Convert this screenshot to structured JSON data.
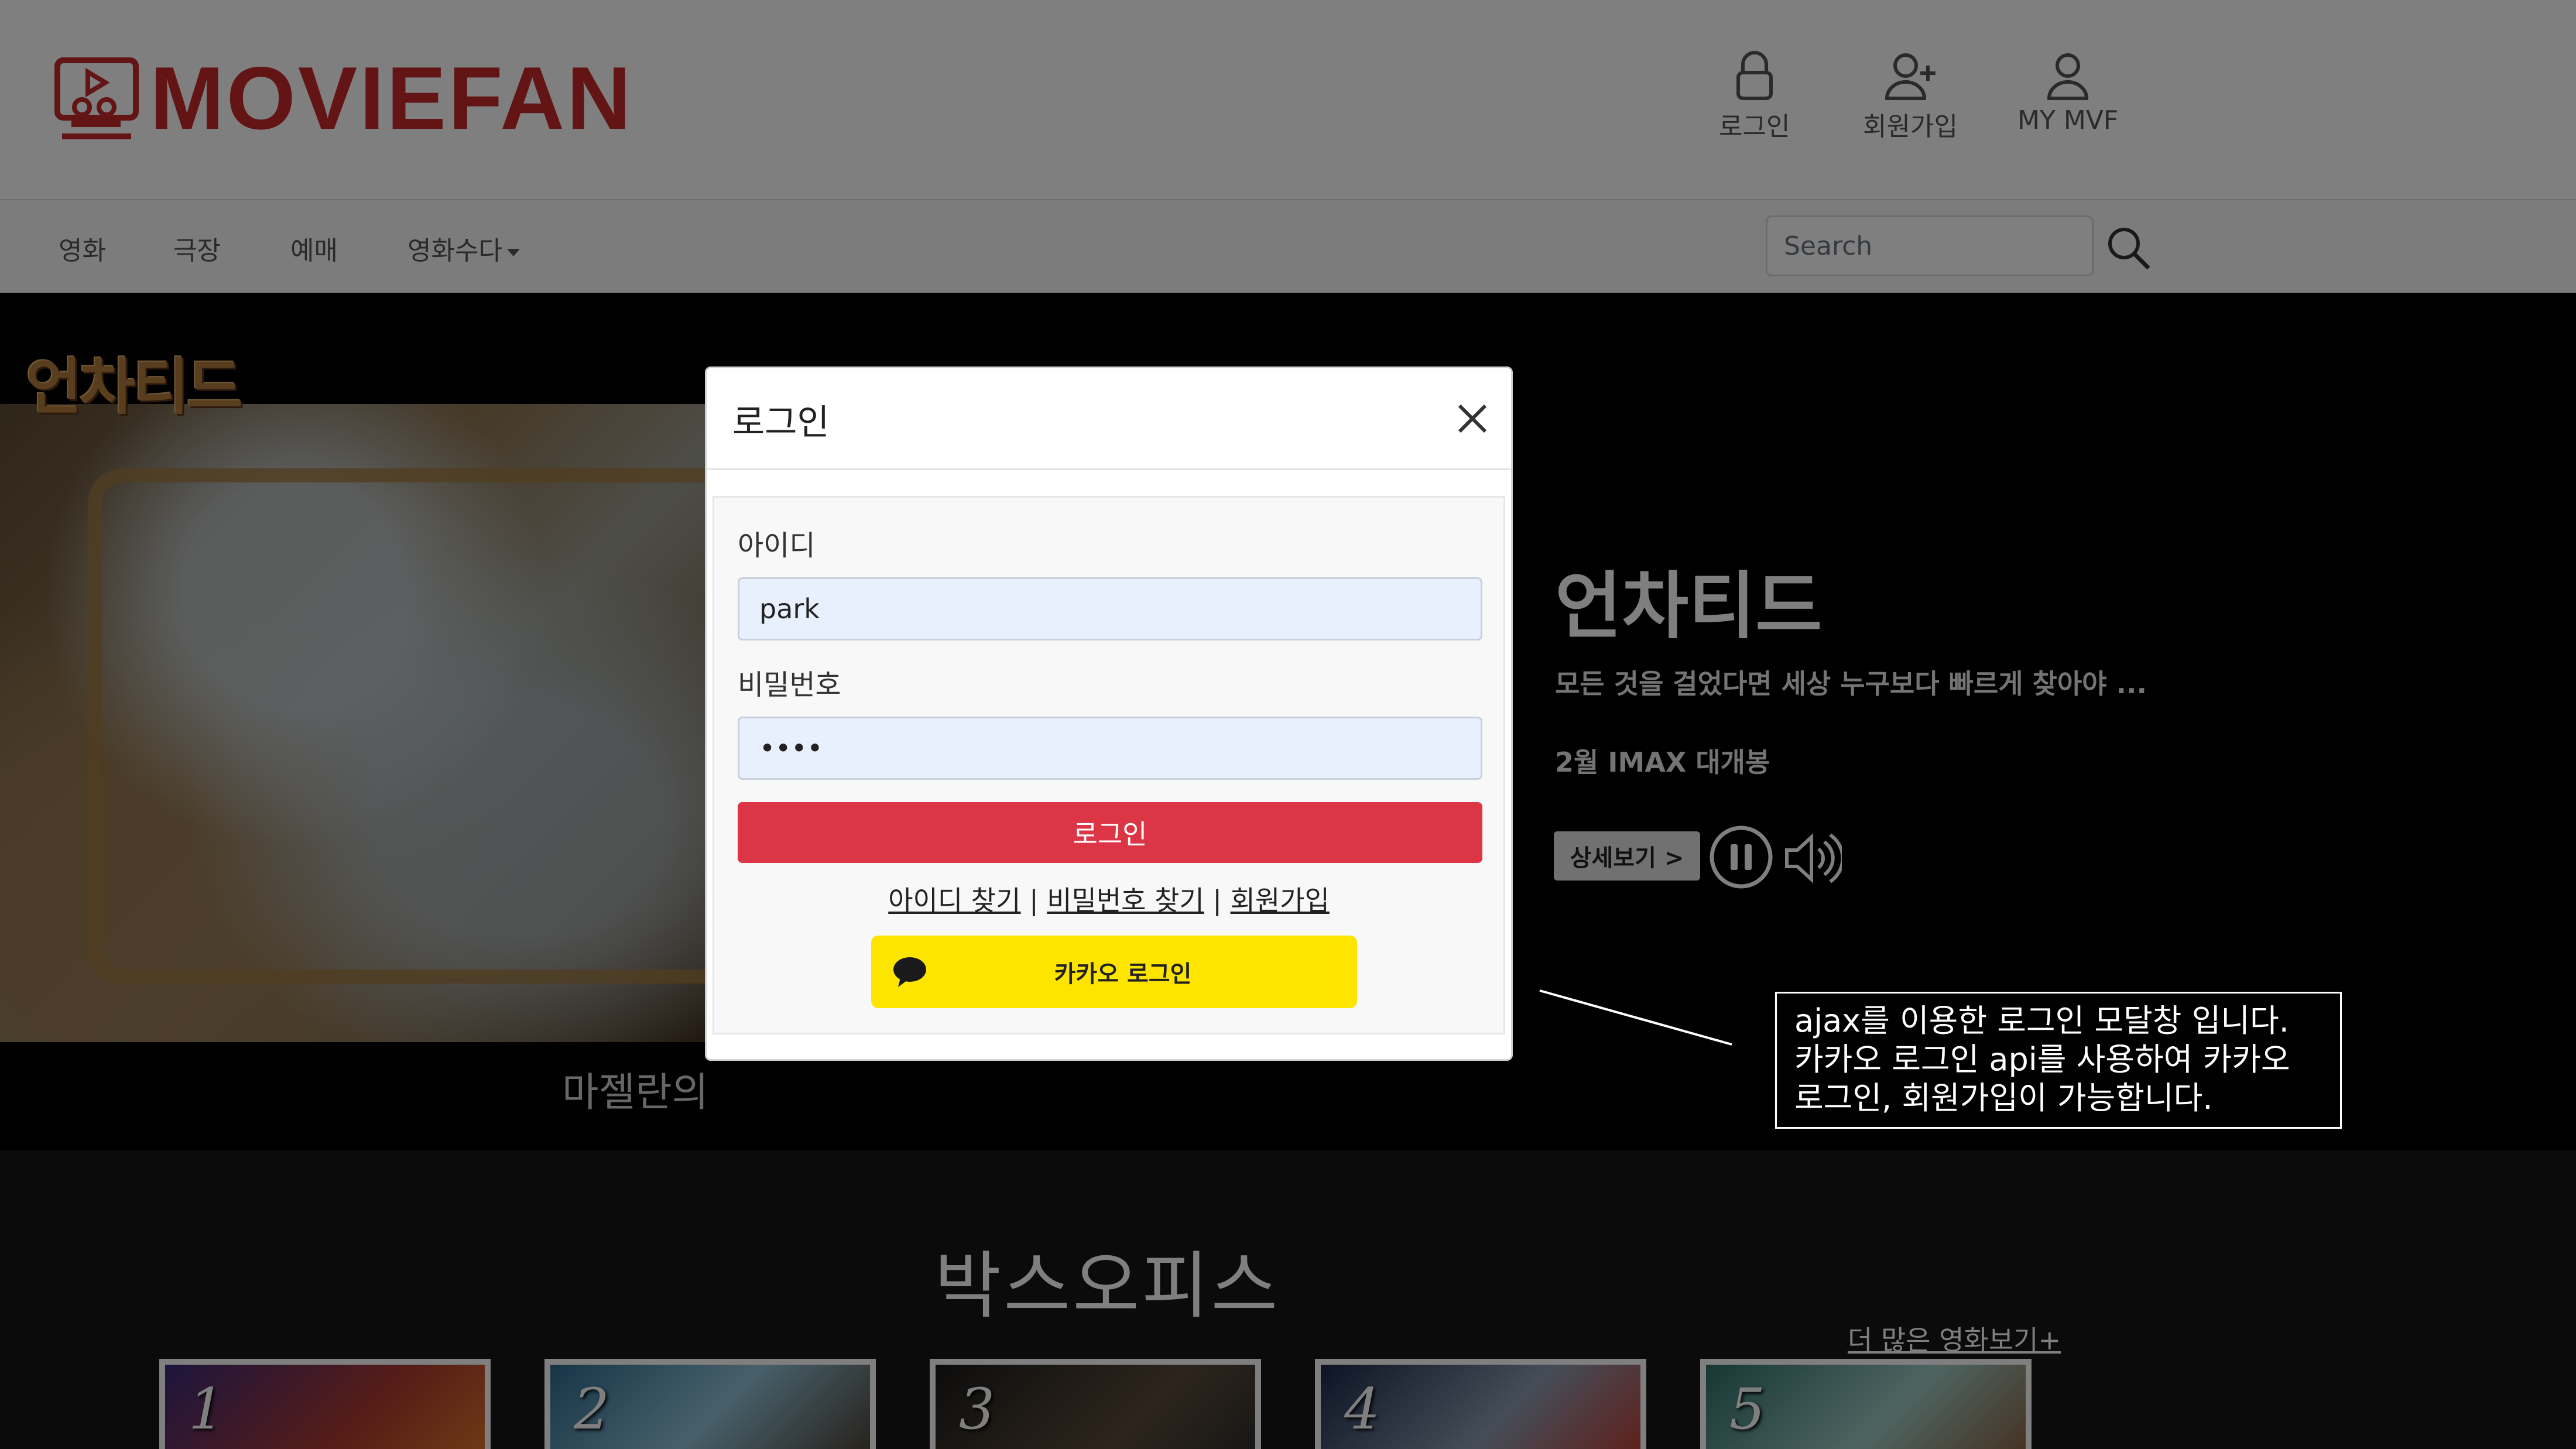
{
  "header": {
    "logo_text": "MOVIEFAN",
    "nav": [
      {
        "label": "로그인",
        "icon": "lock-icon"
      },
      {
        "label": "회원가입",
        "icon": "user-plus-icon"
      },
      {
        "label": "MY MVF",
        "icon": "user-icon"
      }
    ]
  },
  "navbar": {
    "menu": [
      "영화",
      "극장",
      "예매",
      "영화수다"
    ],
    "search_placeholder": "Search"
  },
  "hero": {
    "title_image_text": "언차티드",
    "map_caption": "마젤란의",
    "movie_title": "언차티드",
    "tagline": "모든 것을 걸었다면 세상 누구보다 빠르게 찾아야 ...",
    "release": "2월 IMAX 대개봉",
    "detail_button": "상세보기 >"
  },
  "boxoffice": {
    "title": "박스오피스",
    "more_link": "더 많은 영화보기+",
    "posters": [
      "1",
      "2",
      "3",
      "4",
      "5"
    ]
  },
  "modal": {
    "title": "로그인",
    "id_label": "아이디",
    "id_value": "park",
    "pw_label": "비밀번호",
    "pw_value": "pass",
    "login_button": "로그인",
    "links": [
      "아이디 찾기",
      "비밀번호 찾기",
      "회원가입"
    ],
    "link_separator": "|",
    "kakao_button": "카카오 로그인"
  },
  "annotation": {
    "lines": [
      "ajax를 이용한 로그인 모달창 입니다.",
      "카카오 로그인 api를 사용하여 카카오",
      "로그인, 회원가입이 가능합니다."
    ]
  },
  "colors": {
    "brand_red": "#c62828",
    "login_button": "#dc3545",
    "kakao_yellow": "#fee500",
    "input_autofill": "#e8f0fe"
  }
}
